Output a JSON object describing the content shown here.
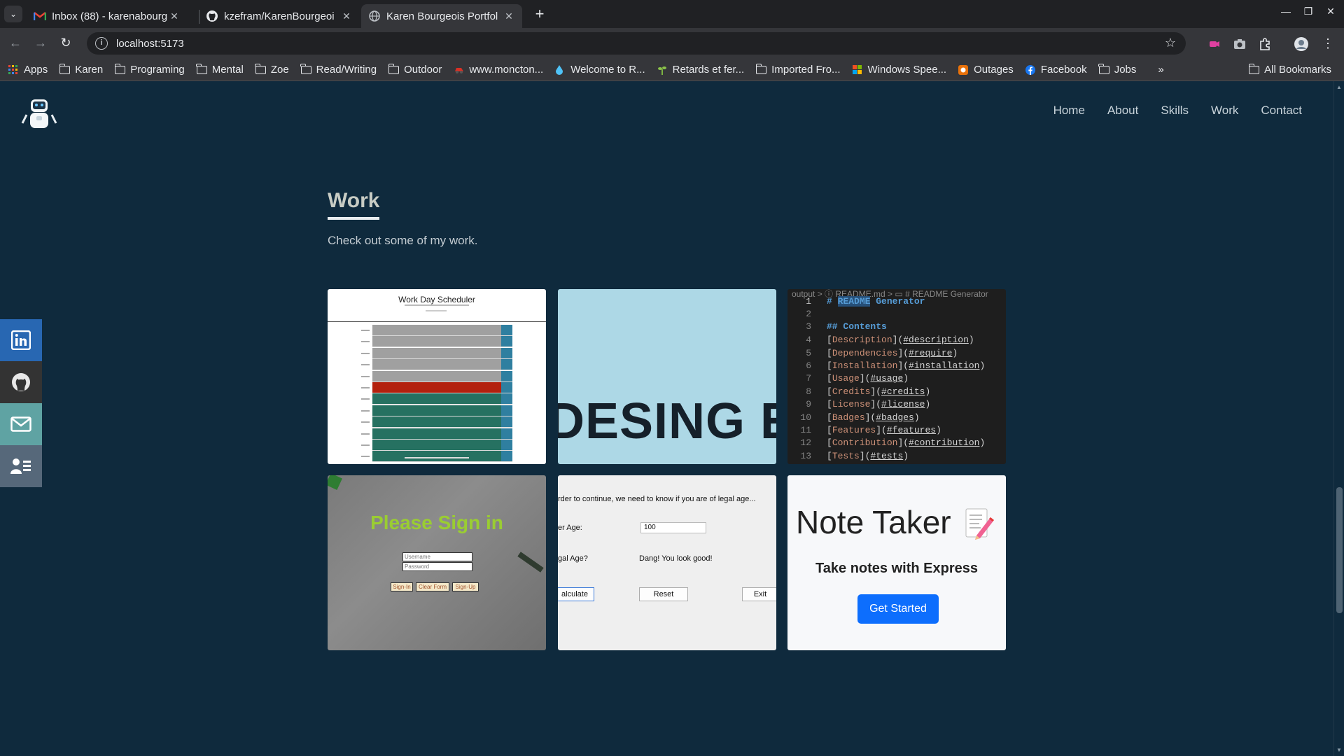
{
  "browser": {
    "tabs": [
      {
        "title": "Inbox (88) - karenabourg",
        "icon": "gmail-icon"
      },
      {
        "title": "kzefram/KarenBourgeoi",
        "icon": "github-icon"
      },
      {
        "title": "Karen Bourgeois Portfol",
        "icon": "globe-icon"
      }
    ],
    "url": "localhost:5173",
    "bookmarks": [
      {
        "label": "Apps",
        "icon": "apps-grid-icon"
      },
      {
        "label": "Karen",
        "icon": "folder-icon"
      },
      {
        "label": "Programing",
        "icon": "folder-icon"
      },
      {
        "label": "Mental",
        "icon": "folder-icon"
      },
      {
        "label": "Zoe",
        "icon": "folder-icon"
      },
      {
        "label": "Read/Writing",
        "icon": "folder-icon"
      },
      {
        "label": "Outdoor",
        "icon": "folder-icon"
      },
      {
        "label": "www.moncton...",
        "icon": "site-icon"
      },
      {
        "label": "Welcome to R...",
        "icon": "site-icon"
      },
      {
        "label": "Retards et fer...",
        "icon": "site-icon"
      },
      {
        "label": "Imported Fro...",
        "icon": "folder-icon"
      },
      {
        "label": "Windows Spee...",
        "icon": "windows-icon"
      },
      {
        "label": "Outages",
        "icon": "site-icon"
      },
      {
        "label": "Facebook",
        "icon": "facebook-icon"
      },
      {
        "label": "Jobs",
        "icon": "folder-icon"
      }
    ],
    "overflow_label": "»",
    "all_bookmarks": "All Bookmarks"
  },
  "site": {
    "nav": [
      "Home",
      "About",
      "Skills",
      "Work",
      "Contact"
    ],
    "social": [
      "linkedin-icon",
      "github-icon",
      "mail-icon",
      "resume-icon"
    ],
    "work": {
      "title": "Work",
      "subtitle": "Check out some of my work."
    }
  },
  "cards": {
    "scheduler": {
      "title": "Work Day Scheduler",
      "rows": [
        "gray",
        "gray",
        "gray",
        "gray",
        "gray",
        "red",
        "green",
        "green",
        "green",
        "green",
        "green",
        "green"
      ]
    },
    "event": {
      "text": "DESING Ev"
    },
    "readme": {
      "breadcrumb": "output > ⓘ README.md > ▭ # README Generator",
      "lines": [
        {
          "n": "1",
          "text": "# README Generator"
        },
        {
          "n": "2",
          "text": ""
        },
        {
          "n": "3",
          "text": "## Contents"
        },
        {
          "n": "4",
          "label": "Description",
          "anchor": "#description"
        },
        {
          "n": "5",
          "label": "Dependencies",
          "anchor": "#require"
        },
        {
          "n": "6",
          "label": "Installation",
          "anchor": "#installation"
        },
        {
          "n": "7",
          "label": "Usage",
          "anchor": "#usage"
        },
        {
          "n": "8",
          "label": "Credits",
          "anchor": "#credits"
        },
        {
          "n": "9",
          "label": "License",
          "anchor": "#license"
        },
        {
          "n": "10",
          "label": "Badges",
          "anchor": "#badges"
        },
        {
          "n": "11",
          "label": "Features",
          "anchor": "#features"
        },
        {
          "n": "12",
          "label": "Contribution",
          "anchor": "#contribution"
        },
        {
          "n": "13",
          "label": "Tests",
          "anchor": "#tests"
        }
      ]
    },
    "signin": {
      "title": "Please Sign in",
      "username_placeholder": "Username",
      "password_placeholder": "Password",
      "buttons": [
        "Sign-In",
        "Clear Form",
        "Sign-Up"
      ]
    },
    "age": {
      "prompt": "rder to continue, we need to know if you are of legal age...",
      "age_label": "er Age:",
      "age_value": "100",
      "legal_label": "gal Age?",
      "result": "Dang! You look good!",
      "buttons": [
        "alculate",
        "Reset",
        "Exit"
      ]
    },
    "notes": {
      "title": "Note Taker",
      "subtitle": "Take notes with Express",
      "button": "Get Started"
    }
  },
  "colors": {
    "page_bg": "#0f2a3d",
    "linkedin": "#2867b2",
    "github": "#333333",
    "mail": "#5fa3a3",
    "resume": "#56687a",
    "primary_button": "#0d6efd"
  }
}
